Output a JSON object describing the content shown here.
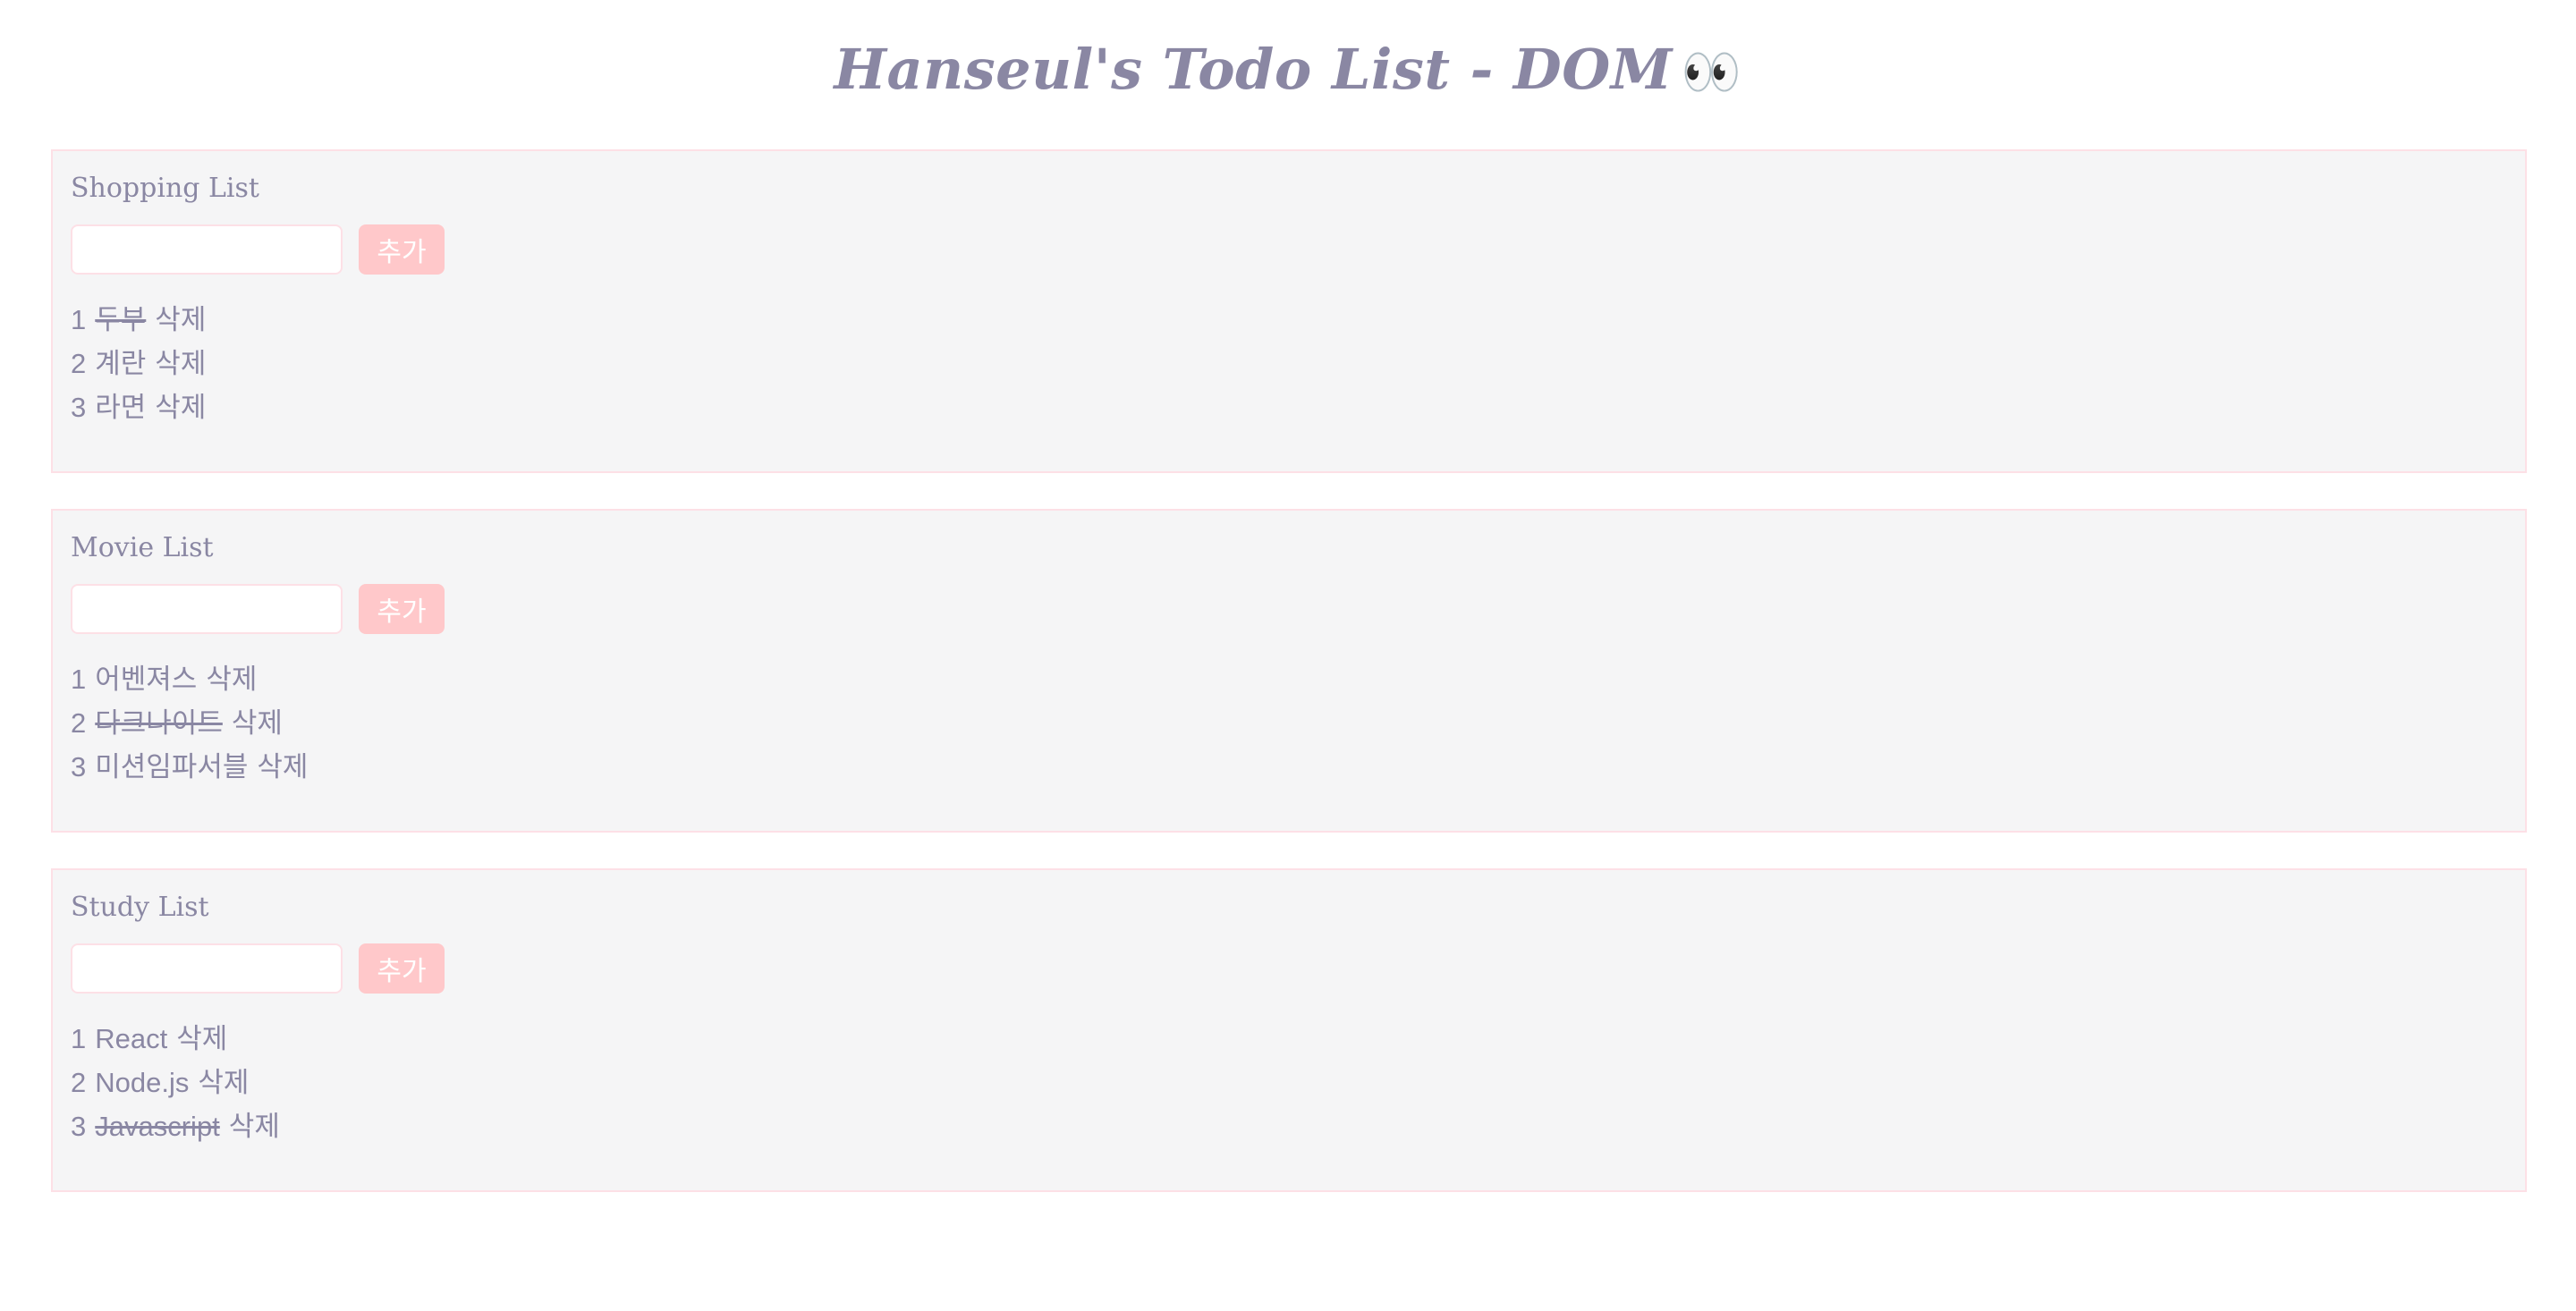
{
  "page": {
    "title": "Hanseul's Todo List - DOM",
    "title_emoji": "👀"
  },
  "colors": {
    "text": "#8a87a3",
    "card_bg": "#f5f5f6",
    "card_border": "#fde0e6",
    "button_bg": "#ffc8ca"
  },
  "lists": [
    {
      "title": "Shopping List",
      "input_value": "",
      "add_label": "추가",
      "items": [
        {
          "num": "1",
          "text": "두부",
          "done": true,
          "delete_label": "삭제"
        },
        {
          "num": "2",
          "text": "계란",
          "done": false,
          "delete_label": "삭제"
        },
        {
          "num": "3",
          "text": "라면",
          "done": false,
          "delete_label": "삭제"
        }
      ]
    },
    {
      "title": "Movie List",
      "input_value": "",
      "add_label": "추가",
      "items": [
        {
          "num": "1",
          "text": "어벤져스",
          "done": false,
          "delete_label": "삭제"
        },
        {
          "num": "2",
          "text": "다크나이트",
          "done": true,
          "delete_label": "삭제"
        },
        {
          "num": "3",
          "text": "미션임파서블",
          "done": false,
          "delete_label": "삭제"
        }
      ]
    },
    {
      "title": "Study List",
      "input_value": "",
      "add_label": "추가",
      "items": [
        {
          "num": "1",
          "text": "React",
          "done": false,
          "delete_label": "삭제"
        },
        {
          "num": "2",
          "text": "Node.js",
          "done": false,
          "delete_label": "삭제"
        },
        {
          "num": "3",
          "text": "Javascript",
          "done": true,
          "delete_label": "삭제"
        }
      ]
    }
  ]
}
